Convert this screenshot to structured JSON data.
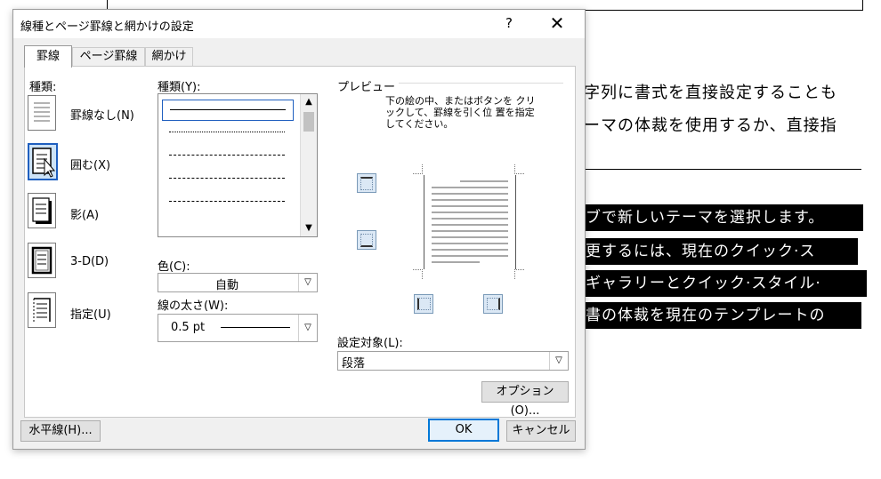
{
  "document": {
    "line1": "字列に書式を直接設定することも",
    "line2": "ーマの体裁を使用するか、直接指",
    "hl1": "ブで新しいテーマを選択します。",
    "hl2": "更するには、現在のクイック·ス",
    "hl3": "ギャラリーとクイック·スタイル·",
    "hl4": "書の体裁を現在のテンプレートの"
  },
  "dialog": {
    "title": "線種とページ罫線と網かけの設定",
    "help": "?",
    "close": "✕",
    "tabs": [
      "罫線",
      "ページ罫線",
      "網かけ"
    ],
    "setting_label": "種類:",
    "settings": [
      "罫線なし(N)",
      "囲む(X)",
      "影(A)",
      "3-D(D)",
      "指定(U)"
    ],
    "style_label": "種類(Y):",
    "color_label": "色(C):",
    "color_value": "自動",
    "width_label": "線の太さ(W):",
    "width_value": "0.5 pt",
    "preview_label": "プレビュー",
    "preview_note": "下の絵の中、またはボタンを クリックして、罫線を引く位 置を指定してください。",
    "apply_label": "設定対象(L):",
    "apply_value": "段落",
    "options_button": "オプション(O)...",
    "horizontal_line_button": "水平線(H)...",
    "ok_button": "OK",
    "cancel_button": "キャンセル"
  }
}
